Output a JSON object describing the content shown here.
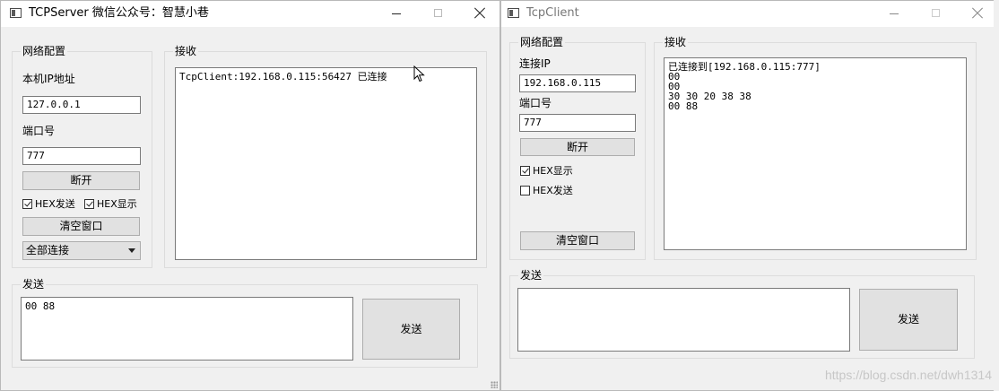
{
  "server": {
    "title": "TCPServer 微信公众号：智慧小巷",
    "config": {
      "group_title": "网络配置",
      "ip_label": "本机IP地址",
      "ip_value": "127.0.0.1",
      "port_label": "端口号",
      "port_value": "777",
      "disconnect_label": "断开",
      "hex_send": {
        "label": "HEX发送",
        "checked": true
      },
      "hex_show": {
        "label": "HEX显示",
        "checked": true
      },
      "clear_label": "清空窗口",
      "target_select": "全部连接"
    },
    "receive": {
      "group_title": "接收",
      "lines": [
        "TcpClient:192.168.0.115:56427 已连接"
      ]
    },
    "send": {
      "group_title": "发送",
      "text": "00 88",
      "send_label": "发送"
    }
  },
  "client": {
    "title": "TcpClient",
    "config": {
      "group_title": "网络配置",
      "ip_label": "连接IP",
      "ip_value": "192.168.0.115",
      "port_label": "端口号",
      "port_value": "777",
      "disconnect_label": "断开",
      "hex_show": {
        "label": "HEX显示",
        "checked": true
      },
      "hex_send": {
        "label": "HEX发送",
        "checked": false
      },
      "clear_label": "清空窗口"
    },
    "receive": {
      "group_title": "接收",
      "lines": [
        "已连接到[192.168.0.115:777]",
        "00",
        "00",
        "30 30 20 38 38",
        "00 88"
      ]
    },
    "send": {
      "group_title": "发送",
      "text": "",
      "send_label": "发送"
    }
  },
  "watermark": "https://blog.csdn.net/dwh1314"
}
